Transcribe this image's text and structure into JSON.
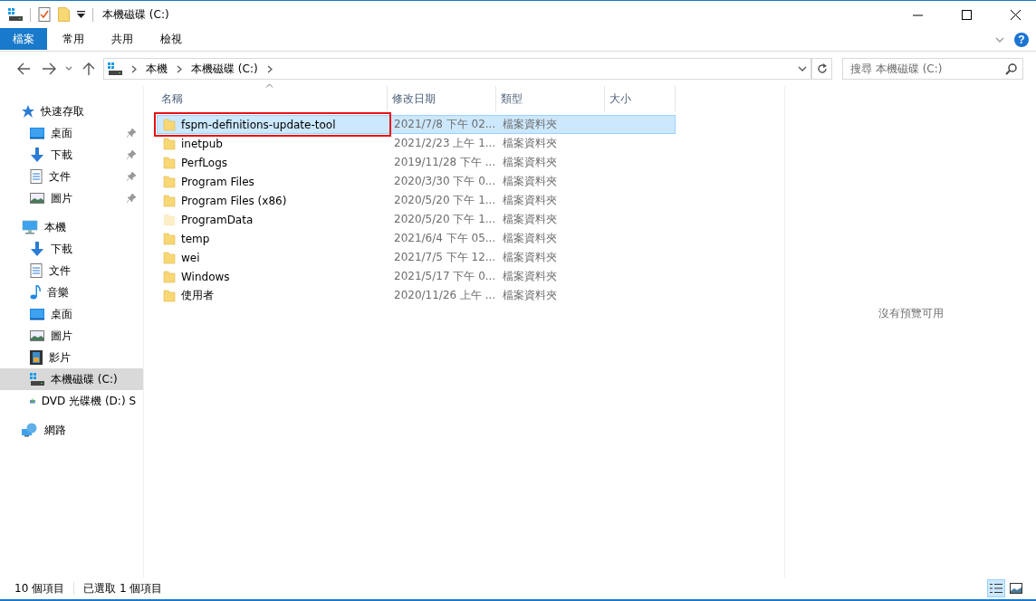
{
  "window": {
    "title": "本機磁碟 (C:)"
  },
  "ribbon": {
    "tabs": [
      {
        "label": "檔案",
        "kind": "file-menu",
        "selected": false
      },
      {
        "label": "常用",
        "kind": "tab",
        "selected": false
      },
      {
        "label": "共用",
        "kind": "tab",
        "selected": false
      },
      {
        "label": "檢視",
        "kind": "tab",
        "selected": false
      }
    ],
    "help_glyph": "?"
  },
  "address": {
    "crumbs": [
      "本機",
      "本機磁碟 (C:)"
    ],
    "search_placeholder": "搜尋 本機磁碟 (C:)"
  },
  "sidebar": {
    "items": [
      {
        "label": "快速存取",
        "kind": "quick-access",
        "selected": false,
        "children": [
          {
            "label": "桌面",
            "kind": "desktop",
            "pinned": true,
            "selected": false
          },
          {
            "label": "下載",
            "kind": "downloads",
            "pinned": true,
            "selected": false
          },
          {
            "label": "文件",
            "kind": "documents",
            "pinned": true,
            "selected": false
          },
          {
            "label": "圖片",
            "kind": "pictures",
            "pinned": true,
            "selected": false
          }
        ]
      },
      {
        "label": "本機",
        "kind": "computer",
        "selected": false,
        "children": [
          {
            "label": "下載",
            "kind": "downloads",
            "pinned": false,
            "selected": false
          },
          {
            "label": "文件",
            "kind": "documents",
            "pinned": false,
            "selected": false
          },
          {
            "label": "音樂",
            "kind": "music",
            "pinned": false,
            "selected": false
          },
          {
            "label": "桌面",
            "kind": "desktop",
            "pinned": false,
            "selected": false
          },
          {
            "label": "圖片",
            "kind": "pictures",
            "pinned": false,
            "selected": false
          },
          {
            "label": "影片",
            "kind": "videos",
            "pinned": false,
            "selected": false
          },
          {
            "label": "本機磁碟 (C:)",
            "kind": "drive",
            "pinned": false,
            "selected": true
          },
          {
            "label": "DVD 光碟機 (D:) S",
            "kind": "dvd",
            "pinned": false,
            "selected": false
          }
        ]
      },
      {
        "label": "網路",
        "kind": "network",
        "selected": false
      }
    ]
  },
  "table": {
    "columns": [
      {
        "label": "名稱",
        "sorted": true
      },
      {
        "label": "修改日期",
        "sorted": false
      },
      {
        "label": "類型",
        "sorted": false
      },
      {
        "label": "大小",
        "sorted": false
      }
    ],
    "rows": [
      {
        "name": "fspm-definitions-update-tool",
        "date": "2021/7/8 下午 02...",
        "type": "檔案資料夾",
        "selected": true,
        "highlighted": true,
        "hidden": false
      },
      {
        "name": "inetpub",
        "date": "2021/2/23 上午 1...",
        "type": "檔案資料夾",
        "selected": false,
        "highlighted": false,
        "hidden": false
      },
      {
        "name": "PerfLogs",
        "date": "2019/11/28 下午 ...",
        "type": "檔案資料夾",
        "selected": false,
        "highlighted": false,
        "hidden": false
      },
      {
        "name": "Program Files",
        "date": "2020/3/30 下午 0...",
        "type": "檔案資料夾",
        "selected": false,
        "highlighted": false,
        "hidden": false
      },
      {
        "name": "Program Files (x86)",
        "date": "2020/5/20 下午 1...",
        "type": "檔案資料夾",
        "selected": false,
        "highlighted": false,
        "hidden": false
      },
      {
        "name": "ProgramData",
        "date": "2020/5/20 下午 1...",
        "type": "檔案資料夾",
        "selected": false,
        "highlighted": false,
        "hidden": true
      },
      {
        "name": "temp",
        "date": "2021/6/4 下午 05...",
        "type": "檔案資料夾",
        "selected": false,
        "highlighted": false,
        "hidden": false
      },
      {
        "name": "wei",
        "date": "2021/7/5 下午 12...",
        "type": "檔案資料夾",
        "selected": false,
        "highlighted": false,
        "hidden": false
      },
      {
        "name": "Windows",
        "date": "2021/5/17 下午 0...",
        "type": "檔案資料夾",
        "selected": false,
        "highlighted": false,
        "hidden": false
      },
      {
        "name": "使用者",
        "date": "2020/11/26 上午 ...",
        "type": "檔案資料夾",
        "selected": false,
        "highlighted": false,
        "hidden": false
      }
    ]
  },
  "preview": {
    "message": "沒有預覽可用"
  },
  "status_bar": {
    "item_count": "10 個項目",
    "selection": "已選取 1 個項目",
    "views": [
      {
        "kind": "details",
        "selected": true
      },
      {
        "kind": "thumbnails",
        "selected": false
      }
    ]
  }
}
